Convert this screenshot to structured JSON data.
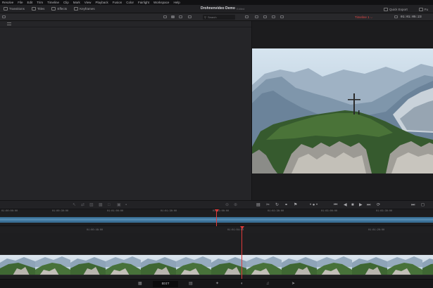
{
  "menu": [
    "Resolve",
    "File",
    "Edit",
    "Trim",
    "Timeline",
    "Clip",
    "Mark",
    "View",
    "Playback",
    "Fusion",
    "Color",
    "Fairlight",
    "Workspace",
    "Help"
  ],
  "toolbar": {
    "transitions": "Transitions",
    "titles": "Titles",
    "effects": "Effects",
    "keyframes": "Keyframes",
    "project_title": "Drohnenvideo Demo",
    "project_status": "Edited",
    "quick_export": "Quick Export",
    "fullscreen": "Fu"
  },
  "subbar": {
    "search_placeholder": "Search",
    "timeline_name": "Timeline 1 ⌵",
    "timecode": "01:01:05:23"
  },
  "ruler_upper": [
    "01:00:00:00",
    "01:00:30:00",
    "01:01:00:00",
    "01:01:30:00",
    "01:02:00:00",
    "01:02:30:00",
    "01:03:00:00",
    "01:03:30:00"
  ],
  "ruler_lower": [
    "01:00:48:00",
    "01:01:04:00",
    "01:01:20:00"
  ],
  "controls": {
    "dots": "• ● •",
    "prev": "⏮",
    "back": "◀",
    "stop": "■",
    "play": "▶",
    "next": "⏭",
    "loop": "⟳"
  },
  "pagebar": {
    "active_label": "EDIT"
  },
  "colors": {
    "playhead": "#e03a3a",
    "timeline_accent": "#3a6f95",
    "timeline_name": "#e04848"
  }
}
